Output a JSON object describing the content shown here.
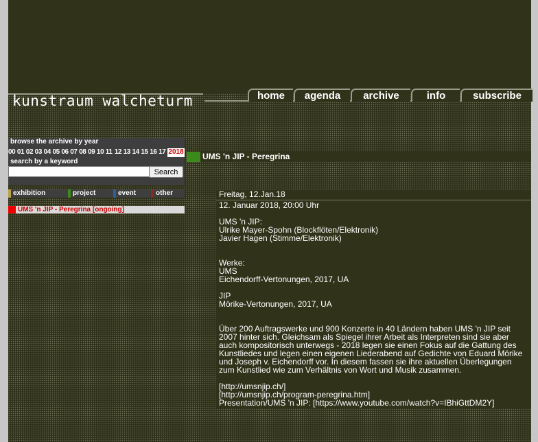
{
  "site": {
    "title": "kunstraum walcheturm"
  },
  "nav": [
    {
      "label": "home"
    },
    {
      "label": "agenda"
    },
    {
      "label": "archive"
    },
    {
      "label": "info"
    },
    {
      "label": "subscribe"
    }
  ],
  "archive": {
    "browse_label": "browse the archive by year",
    "years": [
      "00",
      "01",
      "02",
      "03",
      "04",
      "05",
      "06",
      "07",
      "08",
      "09",
      "10",
      "11",
      "12",
      "13",
      "14",
      "15",
      "16",
      "17"
    ],
    "current_year": "2018",
    "keyword_label": "search by a keyword",
    "search_value": "",
    "search_button": "Search"
  },
  "legend": [
    {
      "label": "exhibition",
      "color": "#b8a24a"
    },
    {
      "label": "project",
      "color": "#3c8a1c"
    },
    {
      "label": "event",
      "color": "#2d5f9a"
    },
    {
      "label": "other",
      "color": "#8a2a1a"
    }
  ],
  "ongoing": {
    "label": "UMS 'n JIP - Peregrina [ongoing]",
    "color": "#ee0000"
  },
  "event": {
    "title": "UMS 'n JIP - Peregrina",
    "color": "#3c8a1c",
    "date": "Freitag, 12.Jan.18",
    "datetime": "12. Januar 2018, 20:00 Uhr",
    "performers_heading": "UMS 'n JIP:",
    "performers": [
      "Ulrike Mayer-Spohn (Blockflöten/Elektronik)",
      "Javier Hagen (Stimme/Elektronik)"
    ],
    "works_heading": "Werke:",
    "work_groups": [
      {
        "composer": "UMS",
        "work": "Eichendorff-Vertonungen, 2017, UA"
      },
      {
        "composer": "JIP",
        "work": "Mörike-Vertonungen, 2017, UA"
      }
    ],
    "description": "Über 200 Auftragswerke und 900 Konzerte in 40 Ländern haben UMS 'n JIP seit 2007 hinter sich. Gleichsam als Spiegel ihrer Arbeit als Interpreten sind sie aber auch kompositorisch unterwegs - 2018 legen sie einen Fokus auf die Gattung des Kunstliedes und legen einen eigenen Liederabend auf Gedichte von Eduard Mörike und Joseph v. Eichendorff vor. In diesem fassen sie ihre aktuellen Überlegungen zum Kunstlied wie zum Verhältnis von Wort und Musik zusammen.",
    "links": [
      "[http://umsnjip.ch/]",
      "[http://umsnjip.ch/program-peregrina.htm]",
      "Presentation/UMS 'n JIP: [https://www.youtube.com/watch?v=IBhiGttDM2Y]"
    ]
  }
}
